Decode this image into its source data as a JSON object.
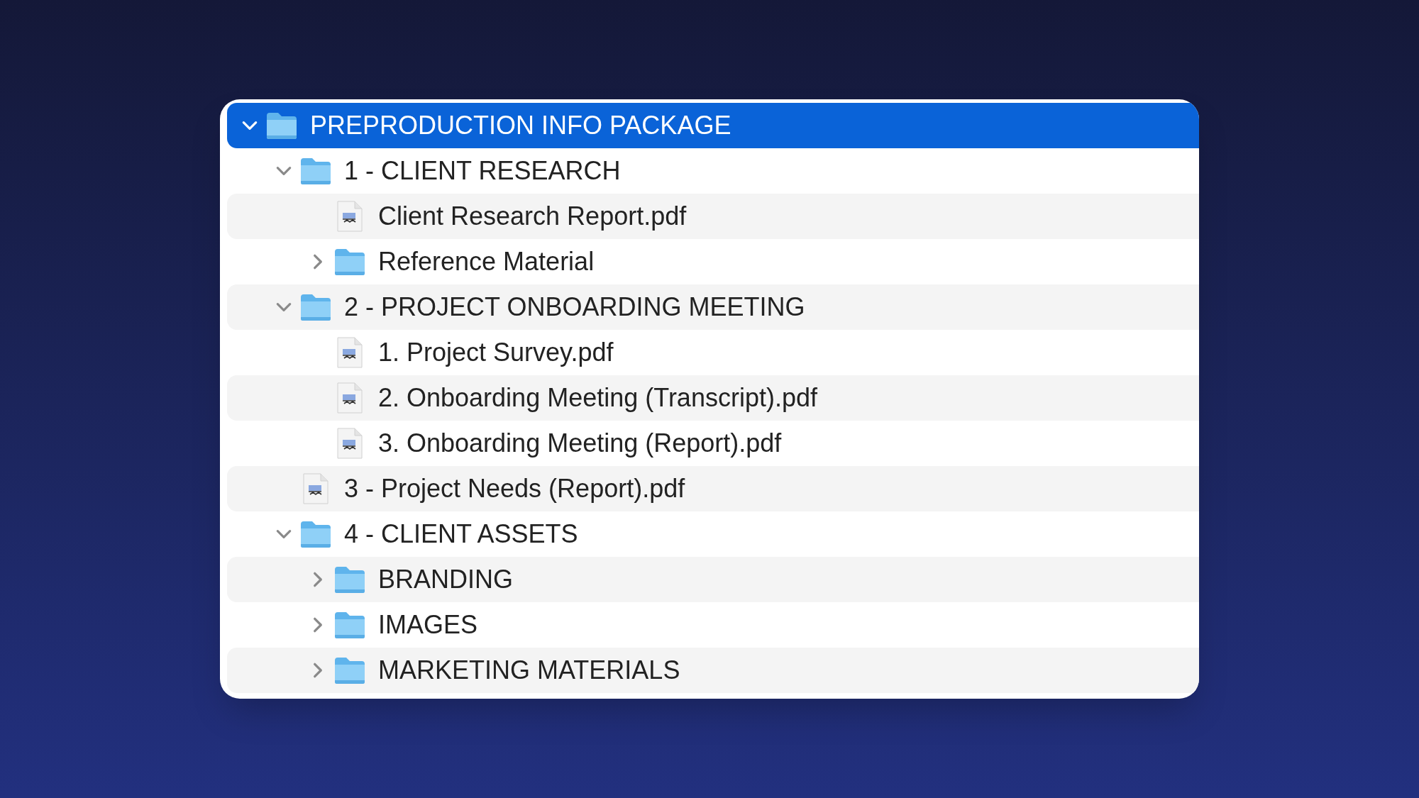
{
  "tree": [
    {
      "kind": "folder",
      "label": "PREPRODUCTION INFO PACKAGE",
      "expanded": true,
      "selected": true,
      "children": [
        {
          "kind": "folder",
          "label": "1 - CLIENT RESEARCH",
          "expanded": true,
          "selected": false,
          "children": [
            {
              "kind": "file",
              "label": "Client Research Report.pdf",
              "selected": false
            },
            {
              "kind": "folder",
              "label": "Reference Material",
              "expanded": false,
              "selected": false
            }
          ]
        },
        {
          "kind": "folder",
          "label": "2 - PROJECT ONBOARDING MEETING",
          "expanded": true,
          "selected": false,
          "children": [
            {
              "kind": "file",
              "label": "1. Project Survey.pdf",
              "selected": false
            },
            {
              "kind": "file",
              "label": "2. Onboarding Meeting (Transcript).pdf",
              "selected": false
            },
            {
              "kind": "file",
              "label": "3. Onboarding Meeting (Report).pdf",
              "selected": false
            }
          ]
        },
        {
          "kind": "file",
          "label": "3 - Project Needs (Report).pdf",
          "selected": false
        },
        {
          "kind": "folder",
          "label": "4 - CLIENT ASSETS",
          "expanded": true,
          "selected": false,
          "children": [
            {
              "kind": "folder",
              "label": "BRANDING",
              "expanded": false,
              "selected": false
            },
            {
              "kind": "folder",
              "label": "IMAGES",
              "expanded": false,
              "selected": false
            },
            {
              "kind": "folder",
              "label": "MARKETING MATERIALS",
              "expanded": false,
              "selected": false
            }
          ]
        }
      ]
    }
  ]
}
